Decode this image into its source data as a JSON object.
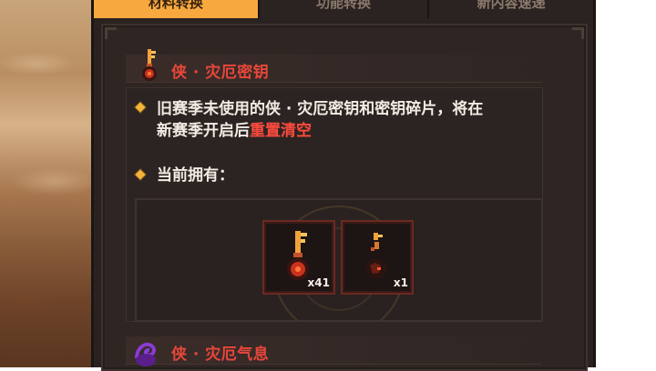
{
  "tabs": [
    {
      "label": "材料转换"
    },
    {
      "label": "功能转换"
    },
    {
      "label": "新内容速递"
    }
  ],
  "section1": {
    "title": "侠 · 灾厄密钥",
    "desc_line1": "旧赛季未使用的侠 · 灾厄密钥和密钥碎片，将在",
    "desc_line2_prefix": "新赛季开启后",
    "desc_line2_highlight": "重置清空",
    "owned_label": "当前拥有："
  },
  "items": [
    {
      "name": "灾厄密钥",
      "icon": "key-icon",
      "count": "x41"
    },
    {
      "name": "密钥碎片",
      "icon": "key-fragment-icon",
      "count": "x1"
    }
  ],
  "section2": {
    "title": "侠 · 灾厄气息"
  },
  "colors": {
    "accent_tab": "#f7a93f",
    "title_red": "#e8473a",
    "bullet_gold": "#f3b23a"
  }
}
